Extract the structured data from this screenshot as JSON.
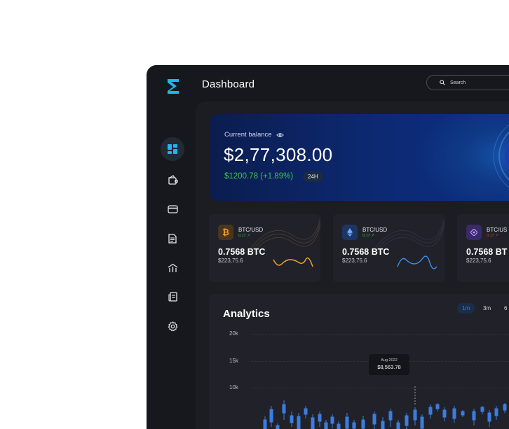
{
  "header": {
    "title": "Dashboard",
    "search_placeholder": "Search"
  },
  "sidebar": {
    "items": [
      {
        "name": "dashboard",
        "active": true
      },
      {
        "name": "wallet"
      },
      {
        "name": "cards"
      },
      {
        "name": "documents"
      },
      {
        "name": "markets"
      },
      {
        "name": "reports"
      },
      {
        "name": "settings"
      }
    ]
  },
  "balance": {
    "label": "Current balance",
    "amount": "$2,77,308.00",
    "change": "$1200.78 (+1.89%)",
    "period": "24H"
  },
  "coins": [
    {
      "pair": "BTC/USD",
      "delta": "0.17 ↗",
      "delta_color": "#3dc24d",
      "amount": "0.7568 BTC",
      "usd": "$223,75.6",
      "icon": "bitcoin-icon",
      "spark_color": "#f0a53a"
    },
    {
      "pair": "BTC/USD",
      "delta": "0.17 ↗",
      "delta_color": "#3dc24d",
      "amount": "0.7568 BTC",
      "usd": "$223,75.6",
      "icon": "ethereum-icon",
      "spark_color": "#3d8ef0"
    },
    {
      "pair": "BTC/US",
      "delta": "0.17 ↗",
      "delta_color": "#e23c3c",
      "amount": "0.7568 BT",
      "usd": "$223,75.6",
      "icon": "token-icon",
      "spark_color": "#9b6cf0"
    }
  ],
  "analytics": {
    "title": "Analytics",
    "ranges": [
      "1m",
      "3m",
      "6"
    ],
    "active_range": "1m",
    "y_ticks": [
      "20k",
      "15k",
      "10k"
    ],
    "tooltip": {
      "date": "Aug 2022",
      "value": "$8,563.78"
    }
  },
  "colors": {
    "accent": "#3b7de0",
    "up": "#3dc24d",
    "down": "#e23c3c",
    "logo": "#1fb6e8"
  }
}
